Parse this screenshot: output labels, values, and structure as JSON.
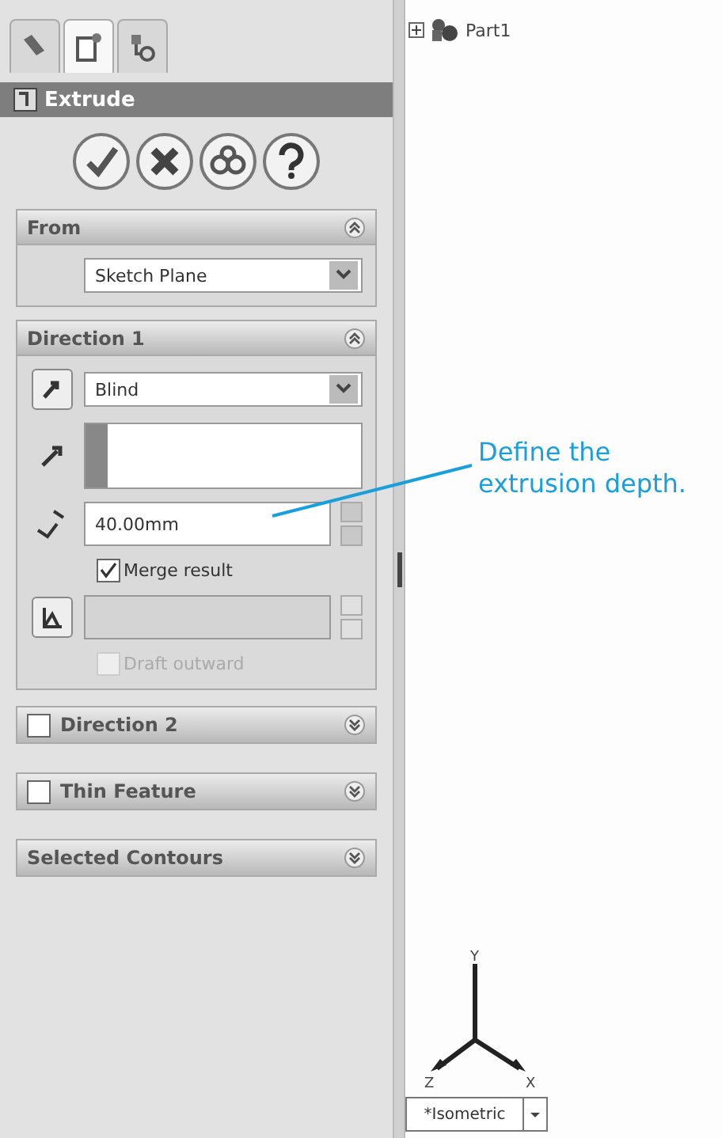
{
  "panel_tabs": [
    {
      "kind": "feature",
      "selected": false
    },
    {
      "kind": "property",
      "selected": true
    },
    {
      "kind": "config",
      "selected": false
    }
  ],
  "feature": {
    "title": "Extrude"
  },
  "actions": [
    {
      "kind": "ok"
    },
    {
      "kind": "cancel"
    },
    {
      "kind": "preview"
    },
    {
      "kind": "help"
    }
  ],
  "from_group": {
    "title": "From",
    "expanded": true,
    "value": "Sketch Plane"
  },
  "direction1": {
    "title": "Direction 1",
    "expanded": true,
    "end_condition": "Blind",
    "depth": "40.00mm",
    "merge_result": {
      "label": "Merge result",
      "checked": true
    },
    "draft_outward": {
      "label": "Draft outward",
      "checked": false,
      "disabled": true
    }
  },
  "collapsed_groups": [
    {
      "title": "Direction 2",
      "kind": "checkbox",
      "checked": false,
      "expanded": false
    },
    {
      "title": "Thin Feature",
      "kind": "checkbox",
      "checked": false,
      "expanded": false
    },
    {
      "title": "Selected Contours",
      "kind": "plain",
      "expanded": false
    }
  ],
  "tree": {
    "label": "Part1",
    "expanded": false
  },
  "triad": {
    "y": "Y",
    "z": "Z",
    "x": "X"
  },
  "view": {
    "value": "*Isometric"
  },
  "callout": "Define the extrusion depth."
}
